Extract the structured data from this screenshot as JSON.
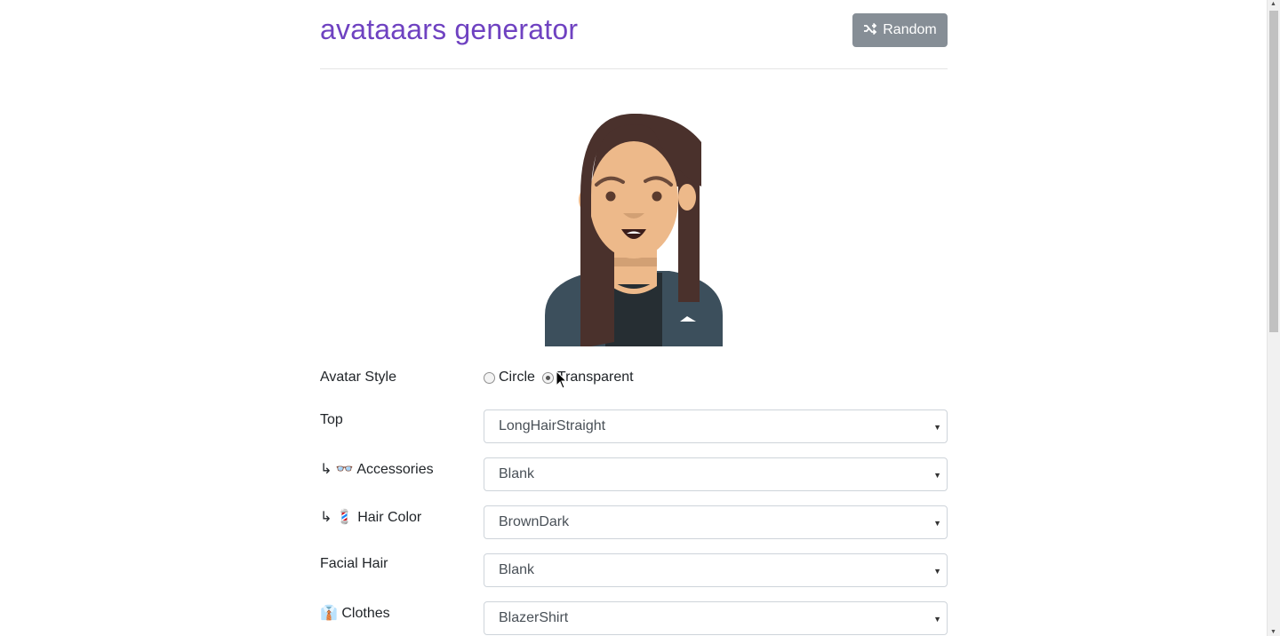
{
  "header": {
    "title": "avataaars generator",
    "random_label": "Random"
  },
  "form": {
    "avatar_style": {
      "label": "Avatar Style",
      "options": [
        {
          "label": "Circle",
          "checked": false
        },
        {
          "label": "Transparent",
          "checked": true
        }
      ]
    },
    "top": {
      "label": "Top",
      "value": "LongHairStraight"
    },
    "accessories": {
      "label": "↳ 👓 Accessories",
      "value": "Blank"
    },
    "hair_color": {
      "label": "↳ 💈 Hair Color",
      "value": "BrownDark"
    },
    "facial_hair": {
      "label": "Facial Hair",
      "value": "Blank"
    },
    "clothes": {
      "label": "👔 Clothes",
      "value": "BlazerShirt"
    }
  },
  "colors": {
    "title": "#6f42c1",
    "button": "#868e96",
    "hair": "#4a312c",
    "skin": "#edb98a",
    "blazer": "#3c4f5c",
    "shirt": "#262e33"
  }
}
